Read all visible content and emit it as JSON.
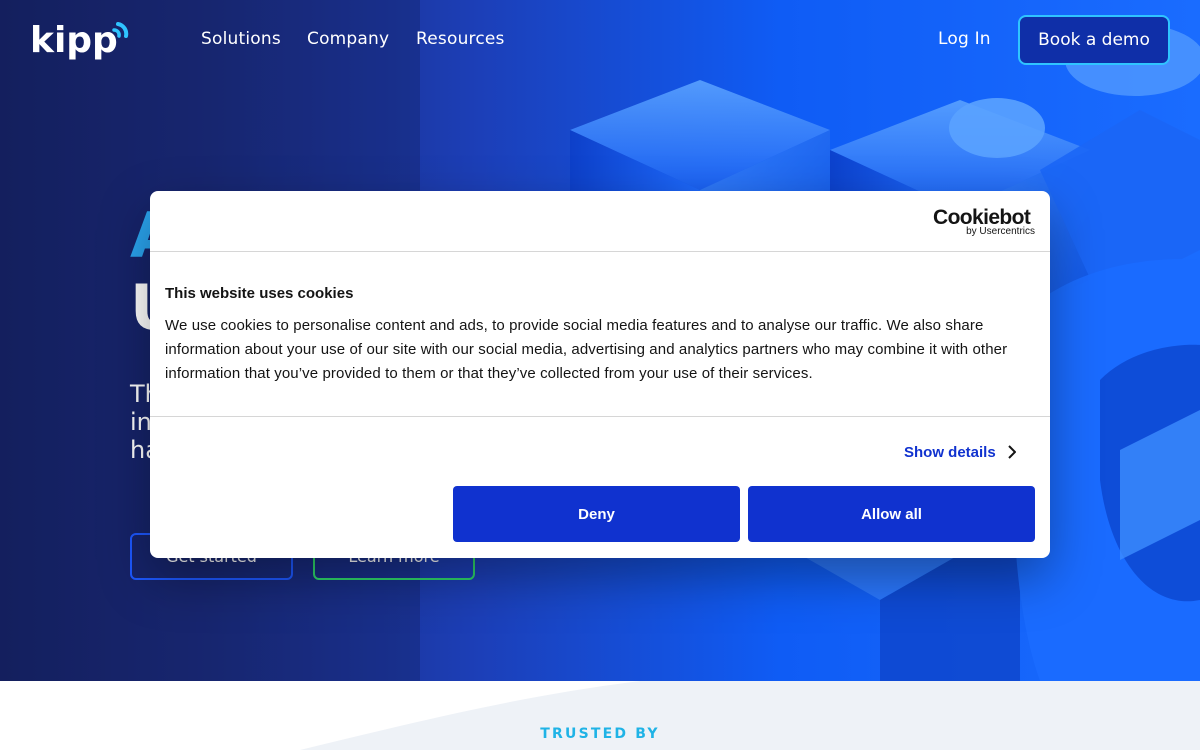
{
  "brand": {
    "logo_text": "kipp"
  },
  "nav": {
    "items": [
      "Solutions",
      "Company",
      "Resources"
    ],
    "login": "Log In",
    "demo_button": "Book a demo"
  },
  "hero": {
    "heading_line1_visible": "A",
    "heading_line2_visible": "U",
    "sub_lines_visible": [
      "Th",
      "in",
      "ha"
    ],
    "get_started": "Get started",
    "learn_more": "Learn more"
  },
  "trusted": {
    "label": "TRUSTED BY"
  },
  "cookie": {
    "provider_brand": "Cookiebot",
    "provider_by": "by Usercentrics",
    "title": "This website uses cookies",
    "body": "We use cookies to personalise content and ads, to provide social media features and to analyse our traffic. We also share information about your use of our site with our social media, advertising and analytics partners who may combine it with other information that you’ve provided to them or that they’ve collected from your use of their services.",
    "show_details": "Show details",
    "deny": "Deny",
    "allow_all": "Allow all"
  },
  "icons": {
    "logo": "kipp-logo-icon",
    "chevron": "chevron-right-icon"
  },
  "colors": {
    "hero_dark": "#14205e",
    "hero_blue": "#0f5cf5",
    "accent_cyan": "#2fc4ff",
    "accent_green": "#2ed66b",
    "cookie_button": "#1032cf",
    "trusted_label": "#1fb3e6"
  }
}
